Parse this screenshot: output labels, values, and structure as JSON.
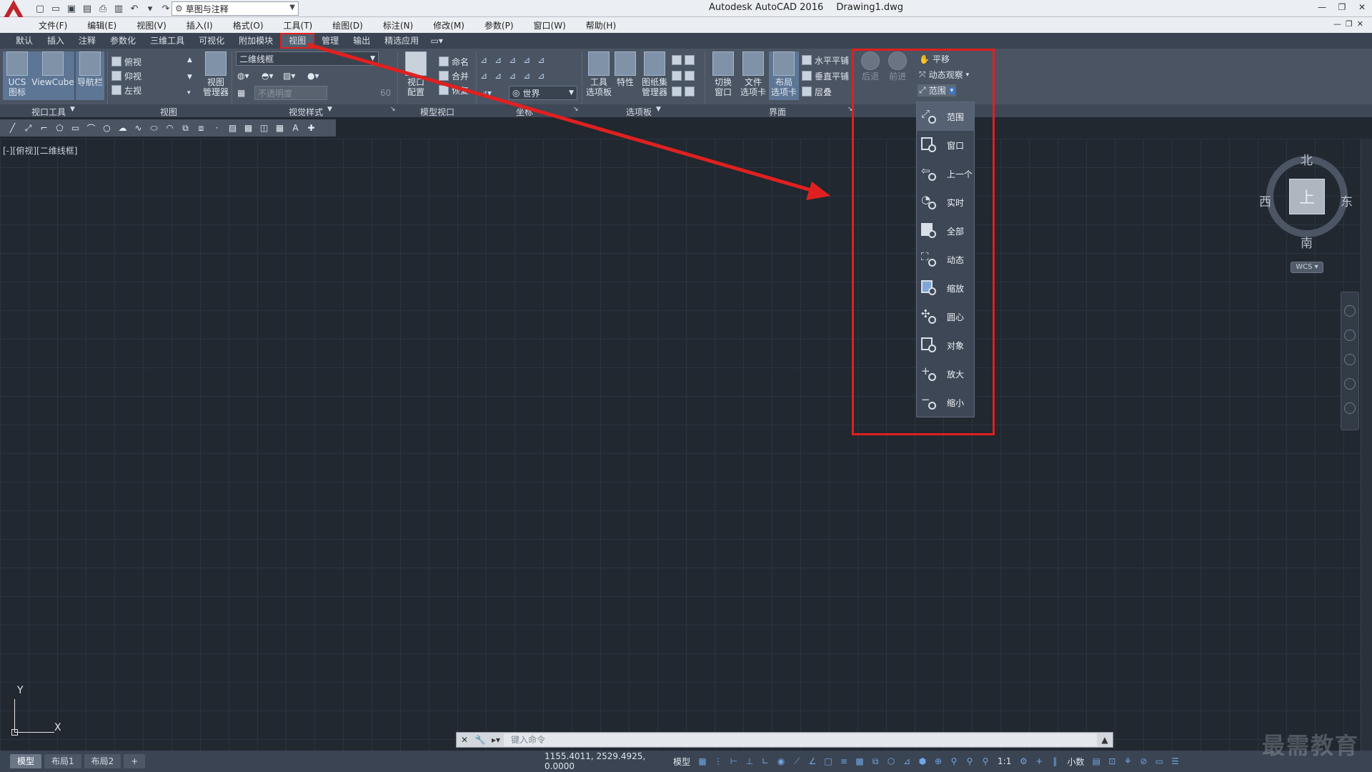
{
  "window": {
    "app_title": "Autodesk AutoCAD 2016",
    "doc_title": "Drawing1.dwg",
    "workspace": "草图与注释"
  },
  "menu": [
    "文件(F)",
    "编辑(E)",
    "视图(V)",
    "插入(I)",
    "格式(O)",
    "工具(T)",
    "绘图(D)",
    "标注(N)",
    "修改(M)",
    "参数(P)",
    "窗口(W)",
    "帮助(H)"
  ],
  "ribbon_tabs": [
    "默认",
    "插入",
    "注释",
    "参数化",
    "三维工具",
    "可视化",
    "附加模块",
    "视图",
    "管理",
    "输出",
    "精选应用"
  ],
  "active_tab_index": 7,
  "ribbon": {
    "viewport_tools": {
      "title": "视口工具",
      "ucs_line1": "UCS",
      "ucs_line2": "图标",
      "viewcube": "ViewCube",
      "navbar": "导航栏"
    },
    "views": {
      "title": "视图",
      "items": [
        "俯视",
        "仰视",
        "左视"
      ],
      "manager_line1": "视图",
      "manager_line2": "管理器"
    },
    "visual_styles": {
      "title": "视觉样式",
      "current": "二维线框",
      "opacity_placeholder": "不透明度",
      "opacity_value": "60"
    },
    "model_viewports": {
      "title": "模型视口",
      "config_line1": "视口",
      "config_line2": "配置",
      "named": "命名",
      "join": "合并",
      "restore": "恢复"
    },
    "coordinates": {
      "title": "坐标",
      "world": "世界"
    },
    "palettes": {
      "title": "选项板",
      "tool_line1": "工具",
      "tool_line2": "选项板",
      "properties": "特性",
      "sheet_line1": "图纸集",
      "sheet_line2": "管理器"
    },
    "interface": {
      "title": "界面",
      "switch_line1": "切换",
      "switch_line2": "窗口",
      "file_line1": "文件",
      "file_line2": "选项卡",
      "layout_line1": "布局",
      "layout_line2": "选项卡",
      "tile_h": "水平平铺",
      "tile_v": "垂直平铺",
      "cascade": "层叠"
    },
    "navigate": {
      "back": "后退",
      "forward": "前进",
      "pan": "平移",
      "orbit": "动态观察",
      "extents": "范围"
    }
  },
  "zoom_menu": [
    "范围",
    "窗口",
    "上一个",
    "实时",
    "全部",
    "动态",
    "缩放",
    "圆心",
    "对象",
    "放大",
    "缩小"
  ],
  "viewport_label": "[-][俯视][二维线框]",
  "viewcube": {
    "north": "北",
    "south": "南",
    "east": "东",
    "west": "西",
    "face": "上",
    "wcs": "WCS"
  },
  "ucs": {
    "x": "X",
    "y": "Y"
  },
  "command_line": {
    "placeholder": "键入命令"
  },
  "layout_tabs": [
    "模型",
    "布局1",
    "布局2"
  ],
  "status": {
    "coords": "1155.4011, 2529.4925, 0.0000",
    "model": "模型",
    "scale": "1:1",
    "units": "小数"
  },
  "watermark": "最需教育",
  "colors": {
    "accent_red": "#e02020",
    "canvas": "#212830",
    "ribbon": "#4a5462"
  }
}
